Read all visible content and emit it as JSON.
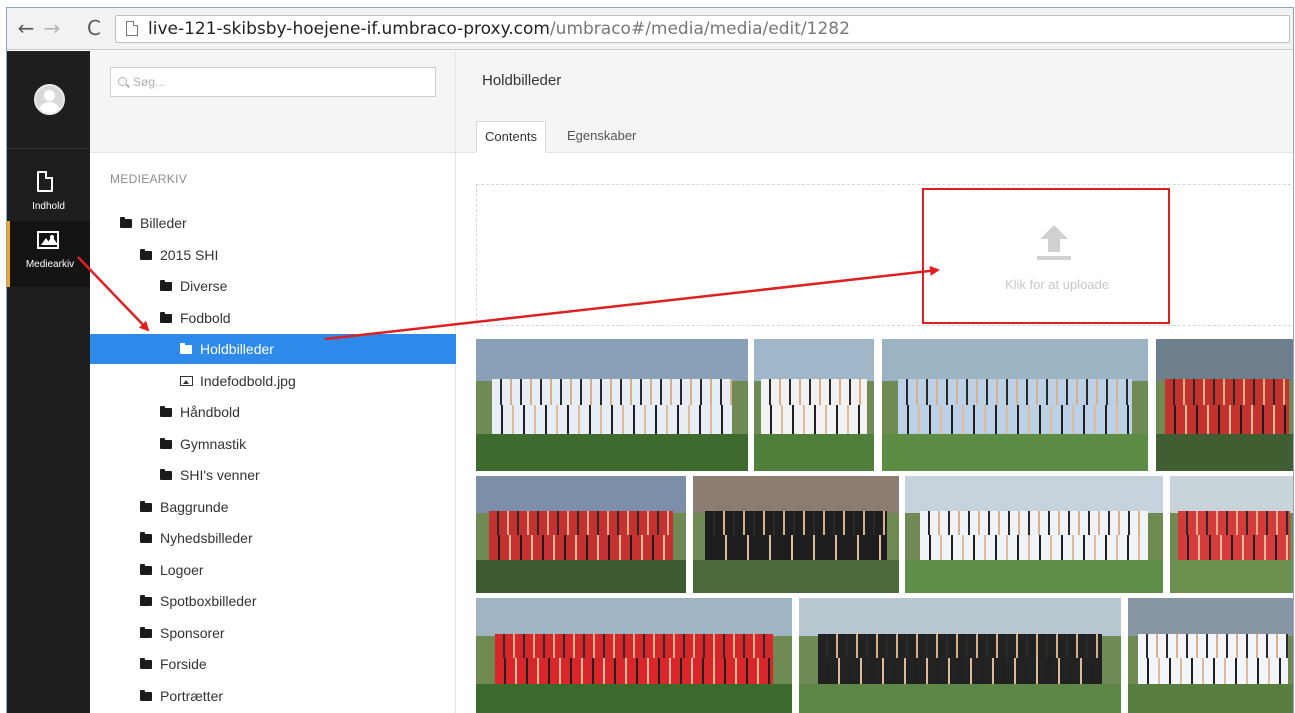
{
  "browser": {
    "url_host": "live-121-skibsby-hoejene-if.umbraco-proxy.com",
    "url_path": "/umbraco#/media/media/edit/1282",
    "back_icon": "←",
    "forward_icon": "→",
    "reload_icon": "C"
  },
  "appnav": {
    "items": [
      {
        "label": "Indhold",
        "icon": "document-icon"
      },
      {
        "label": "Mediearkiv",
        "icon": "image-icon"
      }
    ]
  },
  "tree": {
    "search_placeholder": "Søg...",
    "section_title": "MEDIEARKIV",
    "nodes": [
      {
        "label": "Billeder",
        "type": "folder",
        "level": 0
      },
      {
        "label": "2015 SHI",
        "type": "folder",
        "level": 1
      },
      {
        "label": "Diverse",
        "type": "folder",
        "level": 2
      },
      {
        "label": "Fodbold",
        "type": "folder",
        "level": 2
      },
      {
        "label": "Holdbilleder",
        "type": "folder",
        "level": 3,
        "selected": true
      },
      {
        "label": "Indefodbold.jpg",
        "type": "image",
        "level": 3
      },
      {
        "label": "Håndbold",
        "type": "folder",
        "level": 2
      },
      {
        "label": "Gymnastik",
        "type": "folder",
        "level": 2
      },
      {
        "label": "SHI's venner",
        "type": "folder",
        "level": 2
      },
      {
        "label": "Baggrunde",
        "type": "folder",
        "level": 1
      },
      {
        "label": "Nyhedsbilleder",
        "type": "folder",
        "level": 1
      },
      {
        "label": "Logoer",
        "type": "folder",
        "level": 1
      },
      {
        "label": "Spotboxbilleder",
        "type": "folder",
        "level": 1
      },
      {
        "label": "Sponsorer",
        "type": "folder",
        "level": 1
      },
      {
        "label": "Forside",
        "type": "folder",
        "level": 1
      },
      {
        "label": "Portrætter",
        "type": "folder",
        "level": 1
      }
    ]
  },
  "main": {
    "title": "Holdbilleder",
    "tabs": [
      {
        "label": "Contents",
        "active": true
      },
      {
        "label": "Egenskaber",
        "active": false
      }
    ],
    "upload_text": "Klik for at uploade",
    "photos_count": 12
  },
  "colors": {
    "selected": "#2e8aea",
    "annotation": "#e02020",
    "appnav_bg": "#1e1e1e"
  }
}
